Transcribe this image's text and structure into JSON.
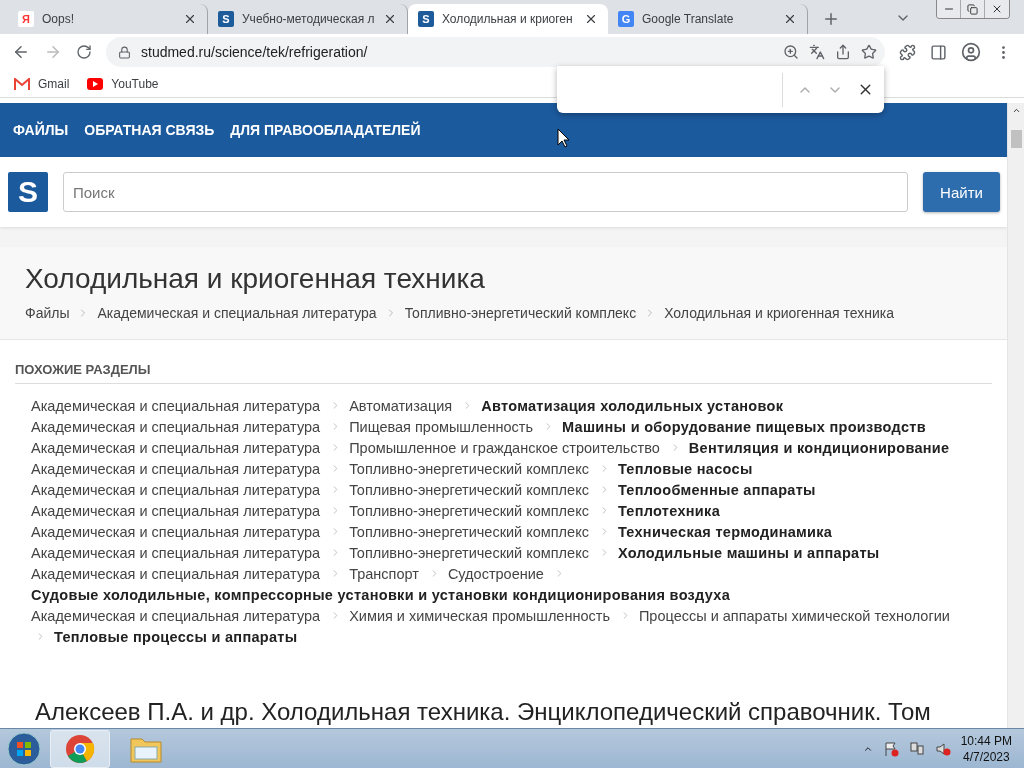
{
  "tabs": [
    {
      "title": "Oops!",
      "kind": "yandex",
      "icon": "Я",
      "selected": false
    },
    {
      "title": "Учебно-методическая л",
      "kind": "studmed",
      "icon": "S",
      "selected": false
    },
    {
      "title": "Холодильная и криоген",
      "kind": "studmed",
      "icon": "S",
      "selected": true
    },
    {
      "title": "Google Translate",
      "kind": "translate",
      "icon": "G",
      "selected": false
    }
  ],
  "address_bar": {
    "url": "studmed.ru/science/tek/refrigeration/"
  },
  "bookmarks": [
    {
      "label": "Gmail",
      "kind": "gmail"
    },
    {
      "label": "YouTube",
      "kind": "youtube"
    }
  ],
  "site_nav": [
    "ФАЙЛЫ",
    "ОБРАТНАЯ СВЯЗЬ",
    "ДЛЯ ПРАВООБЛАДАТЕЛЕЙ"
  ],
  "search": {
    "logo": "S",
    "placeholder": "Поиск",
    "button": "Найти"
  },
  "heading": "Холодильная и криогенная техника",
  "breadcrumbs": [
    "Файлы",
    "Академическая и специальная литература",
    "Топливно-энергетический комплекс",
    "Холодильная и криогенная техника"
  ],
  "related": {
    "title": "ПОХОЖИЕ РАЗДЕЛЫ",
    "rows": [
      {
        "path": [
          "Академическая и специальная литература",
          "Автоматизация"
        ],
        "target": "Автоматизация холодильных установок"
      },
      {
        "path": [
          "Академическая и специальная литература",
          "Пищевая промышленность"
        ],
        "target": "Машины и оборудование пищевых производств"
      },
      {
        "path": [
          "Академическая и специальная литература",
          "Промышленное и гражданское строительство"
        ],
        "target": "Вентиляция и кондиционирование"
      },
      {
        "path": [
          "Академическая и специальная литература",
          "Топливно-энергетический комплекс"
        ],
        "target": "Тепловые насосы"
      },
      {
        "path": [
          "Академическая и специальная литература",
          "Топливно-энергетический комплекс"
        ],
        "target": "Теплообменные аппараты"
      },
      {
        "path": [
          "Академическая и специальная литература",
          "Топливно-энергетический комплекс"
        ],
        "target": "Теплотехника"
      },
      {
        "path": [
          "Академическая и специальная литература",
          "Топливно-энергетический комплекс"
        ],
        "target": "Техническая термодинамика"
      },
      {
        "path": [
          "Академическая и специальная литература",
          "Топливно-энергетический комплекс"
        ],
        "target": "Холодильные машины и аппараты"
      },
      {
        "path": [
          "Академическая и специальная литература",
          "Транспорт",
          "Судостроение"
        ],
        "target": "Судовые холодильные, компрессорные установки и установки кондиционирования воздуха"
      },
      {
        "path": [
          "Академическая и специальная литература",
          "Химия и химическая промышленность",
          "Процессы и аппараты химической технологии"
        ],
        "target": "Тепловые процессы и аппараты"
      }
    ]
  },
  "document_title": "Алексеев П.А. и др. Холодильная техника. Энциклопедический справочник. Том",
  "taskbar": {
    "apps": [
      {
        "kind": "chrome",
        "selected": true
      },
      {
        "kind": "explorer",
        "selected": false
      }
    ],
    "time": "10:44 PM",
    "date": "4/7/2023"
  }
}
